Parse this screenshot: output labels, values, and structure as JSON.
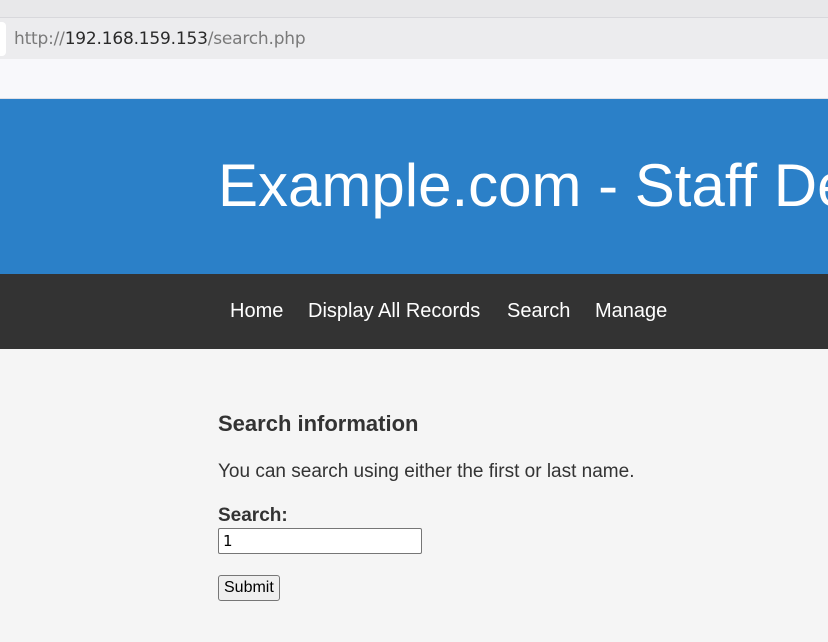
{
  "browser": {
    "url_scheme": "http://",
    "url_host": "192.168.159.153",
    "url_path": "/search.php"
  },
  "header": {
    "title": "Example.com - Staff Details"
  },
  "nav": {
    "items": [
      {
        "label": "Home"
      },
      {
        "label": "Display All Records"
      },
      {
        "label": "Search"
      },
      {
        "label": "Manage"
      }
    ]
  },
  "main": {
    "heading": "Search information",
    "description": "You can search using either the first or last name.",
    "search_label": "Search:",
    "search_value": "1",
    "submit_label": "Submit"
  },
  "colors": {
    "header_bg": "#2b80c8",
    "nav_bg": "#333333",
    "page_bg": "#f5f5f5"
  }
}
